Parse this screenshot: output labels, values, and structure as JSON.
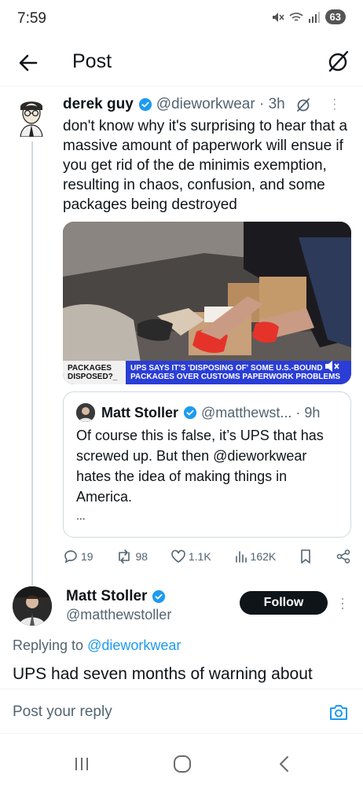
{
  "status_bar": {
    "time": "7:59",
    "battery": "63"
  },
  "header": {
    "title": "Post"
  },
  "tweet": {
    "author_name": "derek guy",
    "handle_time": "@dieworkwear · 3h",
    "text": "don't know why it's surprising to hear that a massive amount of paperwork will ensue if you get rid of the de minimis exemption, resulting in chaos, confusion, and some packages being destroyed",
    "media": {
      "chyron_left": "PACKAGES DISPOSED?_",
      "chyron_right": "UPS SAYS IT'S 'DISPOSING OF' SOME U.S.-BOUND PACKAGES OVER CUSTOMS PAPERWORK PROBLEMS"
    },
    "quote": {
      "author_name": "Matt Stoller",
      "handle_time": "@matthewst... · 9h",
      "text": "Of course this is false, it’s UPS that has screwed up. But then @dieworkwear hates the idea of making things in America.",
      "ellipsis": "..."
    },
    "actions": {
      "replies": "19",
      "reposts": "98",
      "likes": "1.1K",
      "views": "162K"
    }
  },
  "reply": {
    "author_name": "Matt Stoller",
    "handle": "@matthewstoller",
    "follow_label": "Follow",
    "replying_prefix": "Replying to",
    "replying_to": "@dieworkwear",
    "text": "UPS had seven months of warning about"
  },
  "composer": {
    "placeholder": "Post your reply"
  },
  "icons": {
    "back": "back-arrow-icon",
    "grok": "grok-icon",
    "verified": "verified-badge-icon",
    "reply": "reply-icon",
    "repost": "repost-icon",
    "like": "heart-icon",
    "views": "views-icon",
    "bookmark": "bookmark-icon",
    "share": "share-icon",
    "camera": "camera-icon",
    "mute": "mute-icon"
  },
  "colors": {
    "accent": "#1d9bf0",
    "text": "#0f1419",
    "muted": "#536471",
    "follow_bg": "#0f1419"
  }
}
